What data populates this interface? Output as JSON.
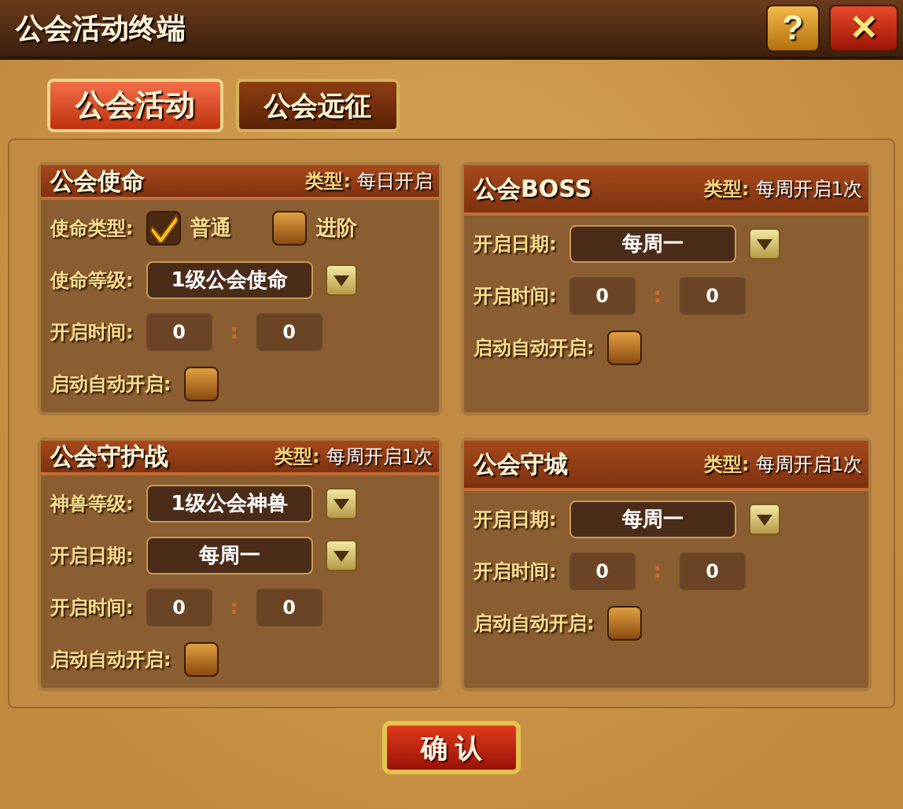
{
  "window": {
    "title": "公会活动终端"
  },
  "title_buttons": [
    {
      "kind": "help",
      "label": "?"
    },
    {
      "kind": "close",
      "label": "✕"
    }
  ],
  "tabs": [
    {
      "label": "公会活动",
      "selected": true
    },
    {
      "label": "公会远征",
      "selected": false
    }
  ],
  "sections": [
    {
      "title": "公会使命",
      "type_label": "类型:",
      "type_value": "每日开启",
      "rows": [
        {
          "kind": "options",
          "label": "使命类型:",
          "options": [
            {
              "label": "普通",
              "checked": true
            },
            {
              "label": "进阶",
              "checked": false
            }
          ]
        },
        {
          "kind": "dropdown",
          "label": "使命等级:",
          "value": "1级公会使命"
        },
        {
          "kind": "time",
          "label": "开启时间:",
          "hour": "0",
          "separator": ":",
          "minute": "0"
        },
        {
          "kind": "toggle",
          "label": "启动自动开启:",
          "checked": false
        }
      ]
    },
    {
      "title": "公会BOSS",
      "type_label": "类型:",
      "type_value": "每周开启1次",
      "rows": [
        {
          "kind": "dropdown",
          "label": "开启日期:",
          "value": "每周一"
        },
        {
          "kind": "time",
          "label": "开启时间:",
          "hour": "0",
          "separator": ":",
          "minute": "0"
        },
        {
          "kind": "toggle",
          "label": "启动自动开启:",
          "checked": false
        }
      ]
    },
    {
      "title": "公会守护战",
      "type_label": "类型:",
      "type_value": "每周开启1次",
      "rows": [
        {
          "kind": "dropdown",
          "label": "神兽等级:",
          "value": "1级公会神兽"
        },
        {
          "kind": "dropdown",
          "label": "开启日期:",
          "value": "每周一"
        },
        {
          "kind": "time",
          "label": "开启时间:",
          "hour": "0",
          "separator": ":",
          "minute": "0"
        },
        {
          "kind": "toggle",
          "label": "启动自动开启:",
          "checked": false
        }
      ]
    },
    {
      "title": "公会守城",
      "type_label": "类型:",
      "type_value": "每周开启1次",
      "rows": [
        {
          "kind": "dropdown",
          "label": "开启日期:",
          "value": "每周一"
        },
        {
          "kind": "time",
          "label": "开启时间:",
          "hour": "0",
          "separator": ":",
          "minute": "0"
        },
        {
          "kind": "toggle",
          "label": "启动自动开启:",
          "checked": false
        }
      ]
    }
  ],
  "confirm_button": {
    "label": "确 认"
  }
}
